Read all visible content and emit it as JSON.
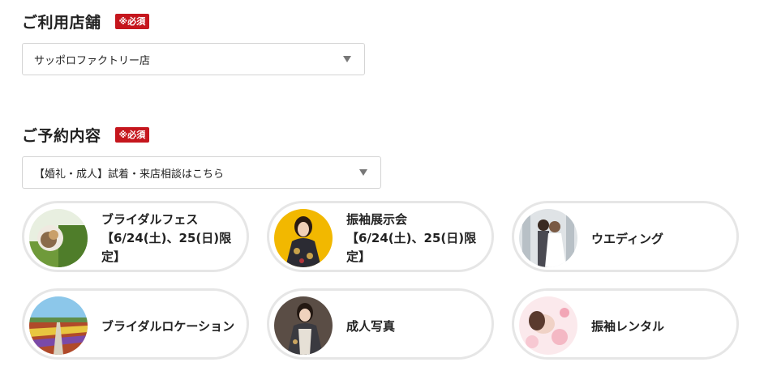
{
  "store": {
    "title": "ご利用店舗",
    "required_badge": "※必須",
    "selected": "サッポロファクトリー店"
  },
  "reservation": {
    "title": "ご予約内容",
    "required_badge": "※必須",
    "selected": "【婚礼・成人】試着・来店相談はこちら"
  },
  "cards": [
    {
      "line1": "ブライダルフェス",
      "line2": "【6/24(土)、25(日)限",
      "line3": "定】",
      "image": "bridal-fair-photo"
    },
    {
      "line1": "振袖展示会",
      "line2": "【6/24(土)、25(日)限",
      "line3": "定】",
      "image": "furisode-exhibition-photo"
    },
    {
      "line1": "ウエディング",
      "image": "wedding-photo"
    },
    {
      "line1": "ブライダルロケーション",
      "image": "flower-field-photo"
    },
    {
      "line1": "成人写真",
      "image": "coming-of-age-photo"
    },
    {
      "line1": "振袖レンタル",
      "image": "furisode-rental-photo"
    }
  ]
}
